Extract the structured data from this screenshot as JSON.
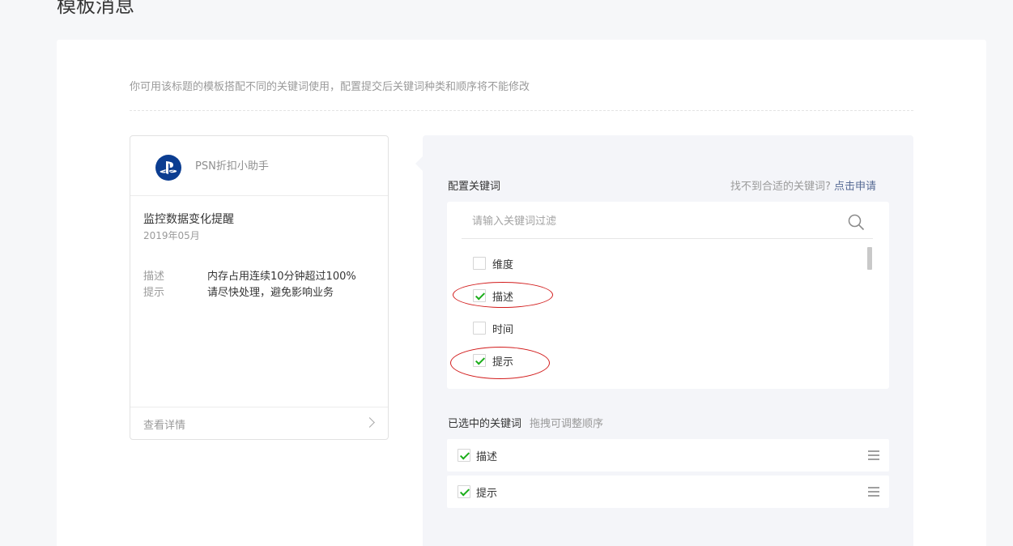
{
  "page": {
    "title": "模板消息",
    "hint": "你可用该标题的模板搭配不同的关键词使用，配置提交后关键词种类和顺序将不能修改"
  },
  "preview": {
    "account_name": "PSN折扣小助手",
    "title": "监控数据变化提醒",
    "date": "2019年05月",
    "fields": [
      {
        "key": "描述",
        "value": "内存占用连续10分钟超过100%"
      },
      {
        "key": "提示",
        "value": "请尽快处理，避免影响业务"
      }
    ],
    "footer_label": "查看详情"
  },
  "config": {
    "label": "配置关键词",
    "help_text": "找不到合适的关键词?",
    "help_link": "点击申请",
    "search_placeholder": "请输入关键词过滤",
    "options": [
      {
        "label": "维度",
        "checked": false,
        "highlighted": false
      },
      {
        "label": "描述",
        "checked": true,
        "highlighted": true
      },
      {
        "label": "时间",
        "checked": false,
        "highlighted": false
      },
      {
        "label": "提示",
        "checked": true,
        "highlighted": true
      }
    ],
    "selected_label": "已选中的关键词",
    "selected_hint": "拖拽可调整顺序",
    "selected": [
      {
        "label": "描述",
        "checked": true
      },
      {
        "label": "提示",
        "checked": true
      }
    ]
  },
  "colors": {
    "accent_green": "#1aad19",
    "link_blue": "#576b95",
    "annotation_red": "#d21b1b",
    "avatar_bg": "#0b3d91"
  }
}
